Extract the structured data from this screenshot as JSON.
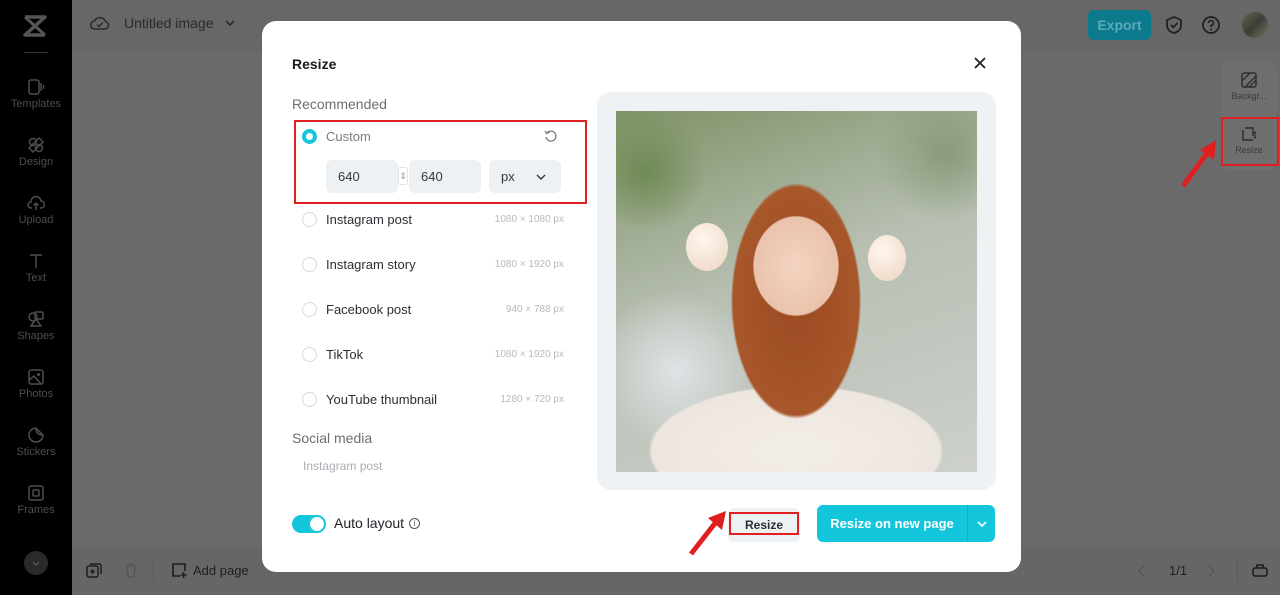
{
  "app": {
    "document_title": "Untitled image"
  },
  "sidebar": {
    "items": [
      {
        "label": "Templates",
        "icon": "templates-icon"
      },
      {
        "label": "Design",
        "icon": "design-icon"
      },
      {
        "label": "Upload",
        "icon": "upload-icon"
      },
      {
        "label": "Text",
        "icon": "text-icon"
      },
      {
        "label": "Shapes",
        "icon": "shapes-icon"
      },
      {
        "label": "Photos",
        "icon": "photos-icon"
      },
      {
        "label": "Stickers",
        "icon": "stickers-icon"
      },
      {
        "label": "Frames",
        "icon": "frames-icon"
      }
    ]
  },
  "header": {
    "export_label": "Export"
  },
  "right_panel": {
    "items": [
      {
        "label": "Backgr...",
        "icon": "background-icon"
      },
      {
        "label": "Resize",
        "icon": "resize-icon"
      }
    ]
  },
  "bottom_bar": {
    "add_page_label": "Add page",
    "page_indicator": "1/1"
  },
  "modal": {
    "title": "Resize",
    "recommended_label": "Recommended",
    "custom": {
      "label": "Custom",
      "width": "640",
      "height": "640",
      "unit": "px",
      "selected": true
    },
    "presets": [
      {
        "label": "Instagram post",
        "size": "1080 × 1080 px"
      },
      {
        "label": "Instagram story",
        "size": "1080 × 1920 px"
      },
      {
        "label": "Facebook post",
        "size": "940 × 788 px"
      },
      {
        "label": "TikTok",
        "size": "1080 × 1920 px"
      },
      {
        "label": "YouTube thumbnail",
        "size": "1280 × 720 px"
      }
    ],
    "social_media_label": "Social media",
    "social_media_first": "Instagram post",
    "auto_layout_label": "Auto layout",
    "auto_layout_on": true,
    "resize_label": "Resize",
    "resize_new_page_label": "Resize on new page"
  },
  "colors": {
    "accent": "#14c6dc",
    "annotation_red": "#e02020",
    "export_button": "#0b7a8c"
  }
}
